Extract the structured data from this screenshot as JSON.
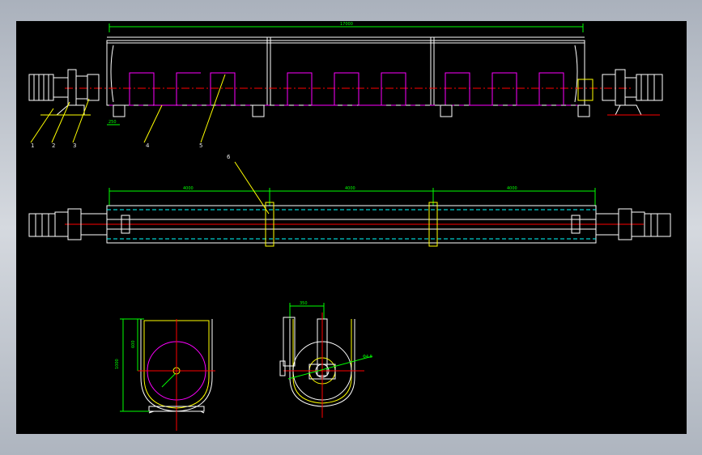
{
  "colors": {
    "background": "#000000",
    "frame": "#c9ced6",
    "outline": "#ffffff",
    "dimension": "#00ff00",
    "centerline": "#ff0000",
    "flight": "#ff00ff",
    "leader": "#ffff00",
    "hidden": "#00ffff"
  },
  "top_view": {
    "overall_dim": "17000",
    "part_labels": [
      "1",
      "2",
      "3",
      "4",
      "5"
    ],
    "small_dim": "250"
  },
  "middle_view": {
    "callout": "6",
    "segment_dims": [
      "4000",
      "4000",
      "4000"
    ]
  },
  "section_left": {
    "height_dim": "1000",
    "inner_dim": "600"
  },
  "section_right": {
    "width_dim": "350",
    "diameter_dim": "Φ4.5"
  }
}
